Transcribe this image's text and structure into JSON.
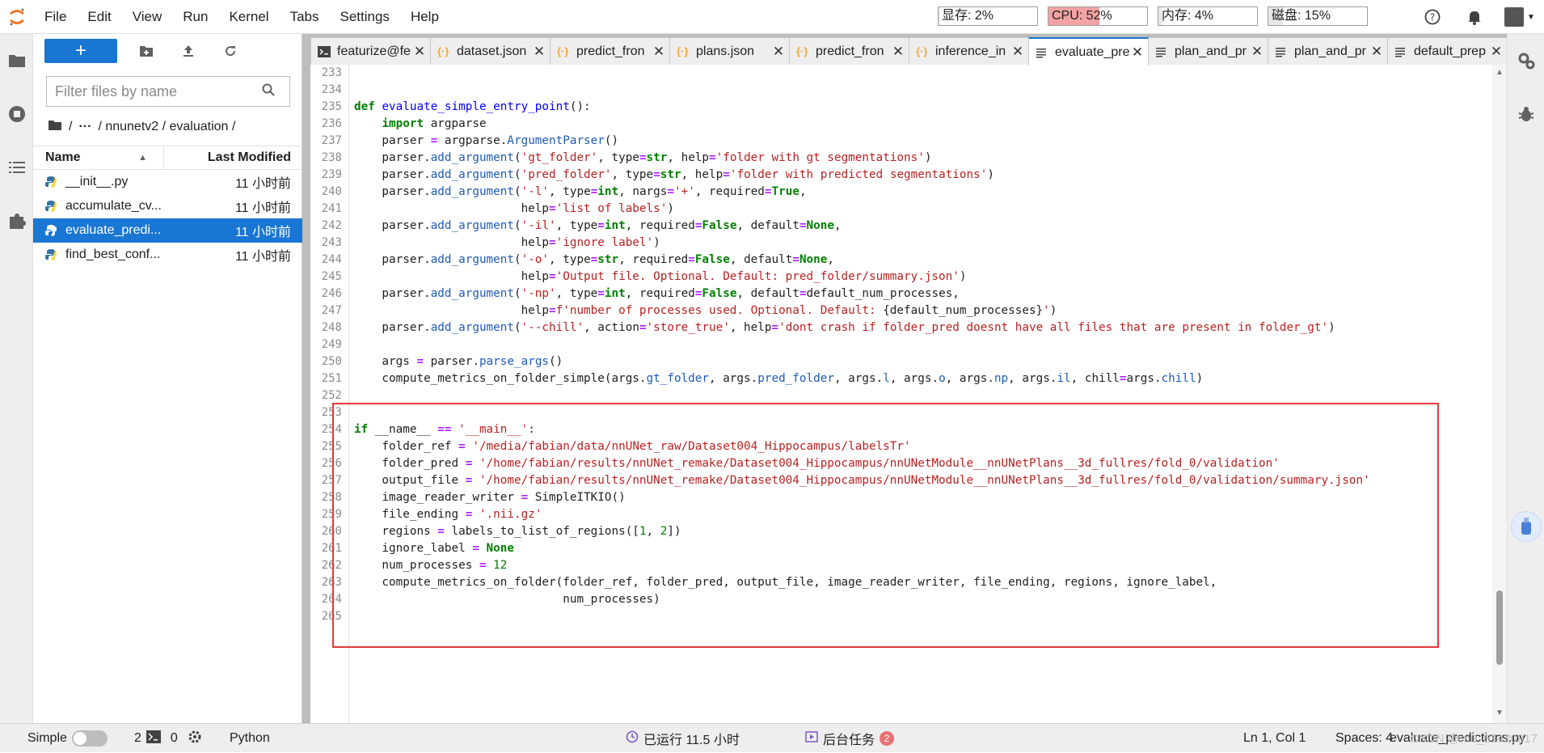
{
  "menubar": {
    "items": [
      "File",
      "Edit",
      "View",
      "Run",
      "Kernel",
      "Tabs",
      "Settings",
      "Help"
    ],
    "monitors": [
      {
        "label": "显存: 2%",
        "level": 0.02
      },
      {
        "label": "CPU: 52%",
        "level": 0.52
      },
      {
        "label": "内存: 4%",
        "level": 0.04
      },
      {
        "label": "磁盘: 15%",
        "level": 0.15
      }
    ]
  },
  "filebrowser": {
    "new_label": "+",
    "filter_placeholder": "Filter files by name",
    "breadcrumb": {
      "root": "/",
      "ellipsis": "···",
      "path": "/ nnunetv2 / evaluation /"
    },
    "columns": {
      "name": "Name",
      "modified": "Last Modified"
    },
    "files": [
      {
        "name": "__init__.py",
        "modified": "11 小时前"
      },
      {
        "name": "accumulate_cv...",
        "modified": "11 小时前"
      },
      {
        "name": "evaluate_predi...",
        "modified": "11 小时前"
      },
      {
        "name": "find_best_conf...",
        "modified": "11 小时前"
      }
    ]
  },
  "tabs": [
    {
      "label": "featurize@fe",
      "icon": "terminal"
    },
    {
      "label": "dataset.json",
      "icon": "json"
    },
    {
      "label": "predict_fron",
      "icon": "json"
    },
    {
      "label": "plans.json",
      "icon": "json"
    },
    {
      "label": "predict_fron",
      "icon": "json"
    },
    {
      "label": "inference_in",
      "icon": "json"
    },
    {
      "label": "evaluate_pre",
      "icon": "file"
    },
    {
      "label": "plan_and_pr",
      "icon": "file"
    },
    {
      "label": "plan_and_pr",
      "icon": "file"
    },
    {
      "label": "default_prep",
      "icon": "file"
    }
  ],
  "editor": {
    "line_numbers": [
      "233",
      "234",
      "235",
      "236",
      "237",
      "238",
      "239",
      "240",
      "241",
      "242",
      "243",
      "244",
      "245",
      "246",
      "247",
      "248",
      "249",
      "250",
      "251",
      "252",
      "253",
      "254",
      "255",
      "256",
      "257",
      "258",
      "259",
      "260",
      "261",
      "262",
      "263",
      "264",
      "265"
    ]
  },
  "statusbar": {
    "mode": "Simple",
    "kernels": "2",
    "terminals": "0",
    "kernel_name": "Python",
    "uptime": "已运行 11.5 小时",
    "background_tasks": "后台任务",
    "background_count": "2",
    "cursor": "Ln 1, Col 1",
    "spaces": "Spaces: 4",
    "filename": "evaluate_predictions.py",
    "watermark": "CSDN @m0_61420917"
  }
}
